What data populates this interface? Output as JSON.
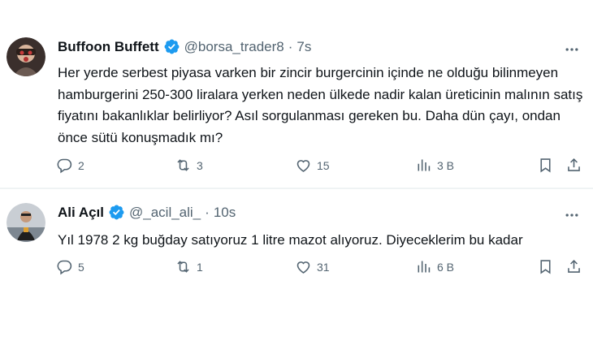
{
  "tweets": [
    {
      "name": "Buffoon Buffett",
      "handle": "@borsa_trader8",
      "separator": "·",
      "time": "7s",
      "text": "Her yerde serbest piyasa varken bir zincir burgercinin içinde ne olduğu bilinmeyen hamburgerini 250-300 liralara yerken neden ülkede nadir kalan üreticinin malının satış fiyatını bakanlıklar belirliyor? Asıl sorgulanması gereken bu. Daha dün çayı, ondan önce sütü konuşmadık mı?",
      "replies": "2",
      "retweets": "3",
      "likes": "15",
      "views": "3 B"
    },
    {
      "name": "Ali Açıl",
      "handle": "@_acil_ali_",
      "separator": "·",
      "time": "10s",
      "text": "Yıl 1978 2 kg buğday satıyoruz 1 litre mazot alıyoruz. Diyeceklerim bu kadar",
      "replies": "5",
      "retweets": "1",
      "likes": "31",
      "views": "6 B"
    }
  ],
  "icons": {
    "verified": "verified-badge-icon",
    "more": "more-options-icon",
    "reply": "reply-icon",
    "retweet": "retweet-icon",
    "like": "heart-icon",
    "views": "views-bar-chart-icon",
    "bookmark": "bookmark-icon",
    "share": "share-icon"
  },
  "colors": {
    "verified": "#1d9bf0",
    "secondary_text": "#536471",
    "primary_text": "#0f1419",
    "divider": "#eff3f4"
  }
}
